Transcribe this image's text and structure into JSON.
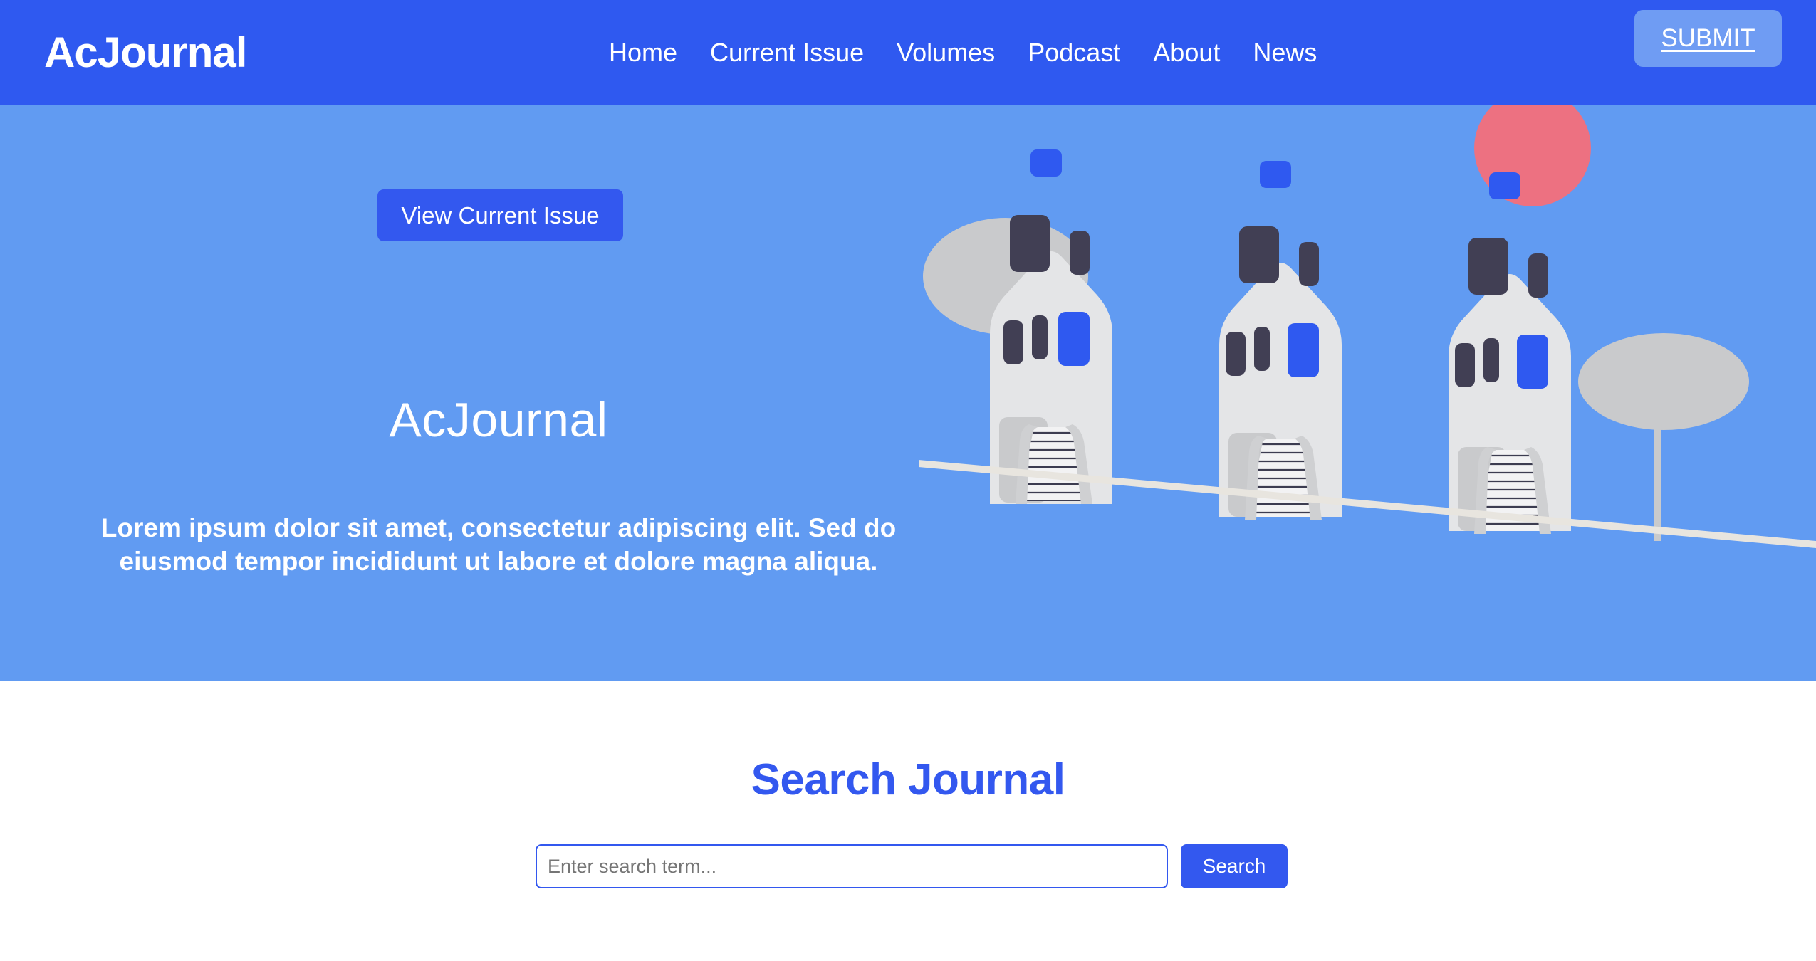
{
  "header": {
    "brand": "AcJournal",
    "nav": [
      {
        "label": "Home"
      },
      {
        "label": "Current Issue"
      },
      {
        "label": "Volumes"
      },
      {
        "label": "Podcast"
      },
      {
        "label": "About"
      },
      {
        "label": "News"
      }
    ],
    "submit_label": "SUBMIT",
    "background_color": "#2F59F0",
    "submit_background_color": "#6F9CF3"
  },
  "hero": {
    "cta_label": "View Current Issue",
    "title": "AcJournal",
    "subtitle": "Lorem ipsum dolor sit amet, consectetur adipiscing elit. Sed do eiusmod tempor incididunt ut labore et dolore magna aliqua.",
    "background_color": "#619BF2",
    "cta_background_color": "#3358EF",
    "illustration": {
      "name": "houses-street-illustration",
      "house_body_color": "#E4E5E7",
      "window_dark_color": "#413F54",
      "window_blue_color": "#2F59F0",
      "tree_color": "#C9CACC",
      "sun_color": "#ED7181",
      "ground_color": "#E8E5DF"
    }
  },
  "search": {
    "title": "Search Journal",
    "placeholder": "Enter search term...",
    "value": "",
    "button_label": "Search",
    "accent_color": "#3358EF"
  }
}
